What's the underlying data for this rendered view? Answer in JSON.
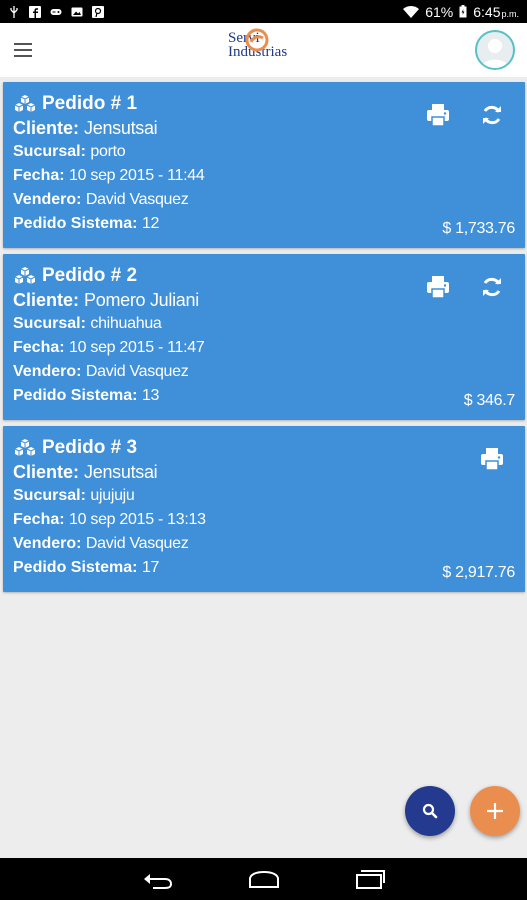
{
  "status_bar": {
    "battery": "61%",
    "time": "6:45",
    "ampm": "p.m."
  },
  "app": {
    "logo_line1": "Servi",
    "logo_line2": "Industrias",
    "brand_color": "#1b3a8a",
    "accent_color": "#ea8e4f",
    "card_color": "#3f8fd9"
  },
  "labels": {
    "cliente": "Cliente:",
    "sucursal": "Sucursal:",
    "fecha": "Fecha:",
    "vendero": "Vendero:",
    "pedido_sistema": "Pedido Sistema:"
  },
  "orders": [
    {
      "title": "Pedido # 1",
      "cliente": "Jensutsai",
      "sucursal": "porto",
      "fecha": "10 sep 2015 - 11:44",
      "vendero": "David Vasquez",
      "pedido_sistema": "12",
      "total": "$ 1,733.76",
      "actions": [
        "printer-icon",
        "sync-icon"
      ]
    },
    {
      "title": "Pedido # 2",
      "cliente": "Pomero Juliani",
      "sucursal": "chihuahua",
      "fecha": "10 sep 2015 - 11:47",
      "vendero": "David Vasquez",
      "pedido_sistema": "13",
      "total": "$ 346.7",
      "actions": [
        "printer-icon",
        "sync-icon"
      ]
    },
    {
      "title": "Pedido # 3",
      "cliente": "Jensutsai",
      "sucursal": "ujujuju",
      "fecha": "10 sep 2015 - 13:13",
      "vendero": "David Vasquez",
      "pedido_sistema": "17",
      "total": "$ 2,917.76",
      "actions": [
        "printer-icon"
      ]
    }
  ],
  "fabs": {
    "search": "search-icon",
    "add": "plus-icon"
  },
  "nav": [
    "back-icon",
    "home-icon",
    "recents-icon"
  ]
}
